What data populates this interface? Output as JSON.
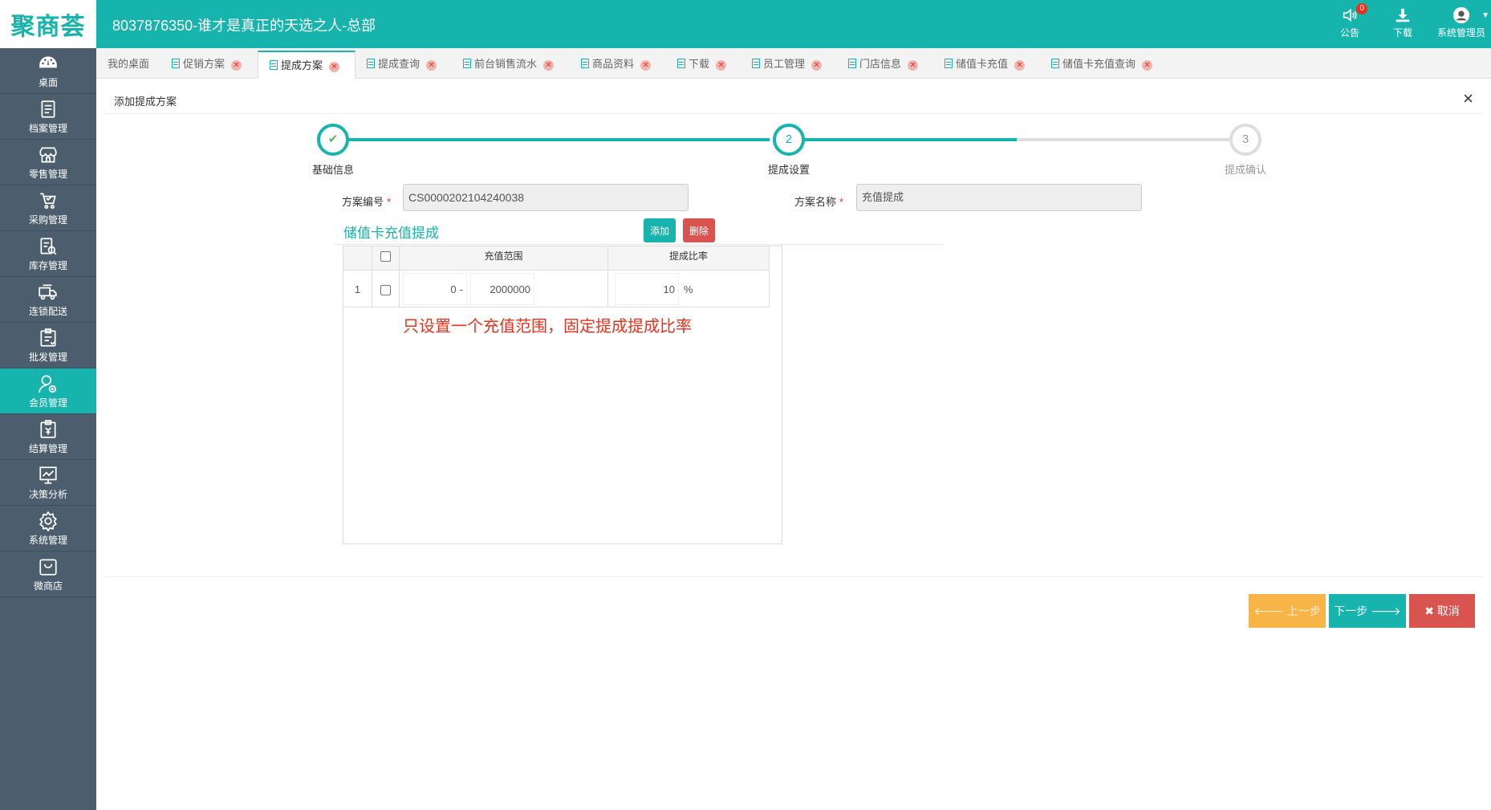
{
  "header": {
    "logo": "聚商荟",
    "title": "8037876350-谁才是真正的天选之人-总部",
    "notice_label": "公告",
    "notice_count": "0",
    "download_label": "下载",
    "user_label": "系统管理员"
  },
  "sidebar": {
    "items": [
      {
        "label": "桌面",
        "icon": "dashboard-icon"
      },
      {
        "label": "档案管理",
        "icon": "archive-icon"
      },
      {
        "label": "零售管理",
        "icon": "store-icon"
      },
      {
        "label": "采购管理",
        "icon": "cart-icon"
      },
      {
        "label": "库存管理",
        "icon": "inventory-icon"
      },
      {
        "label": "连锁配送",
        "icon": "truck-icon"
      },
      {
        "label": "批发管理",
        "icon": "wholesale-icon"
      },
      {
        "label": "会员管理",
        "icon": "member-icon"
      },
      {
        "label": "结算管理",
        "icon": "settlement-icon"
      },
      {
        "label": "决策分析",
        "icon": "chart-icon"
      },
      {
        "label": "系统管理",
        "icon": "gear-icon"
      },
      {
        "label": "微商店",
        "icon": "shop-bag-icon"
      }
    ]
  },
  "tabs": [
    {
      "label": "我的桌面"
    },
    {
      "label": "促销方案"
    },
    {
      "label": "提成方案"
    },
    {
      "label": "提成查询"
    },
    {
      "label": "前台销售流水"
    },
    {
      "label": "商品资料"
    },
    {
      "label": "下载"
    },
    {
      "label": "员工管理"
    },
    {
      "label": "门店信息"
    },
    {
      "label": "储值卡充值"
    },
    {
      "label": "储值卡充值查询"
    }
  ],
  "panel": {
    "title": "添加提成方案",
    "close": "×"
  },
  "steps": [
    {
      "label": "基础信息",
      "number": "✔"
    },
    {
      "label": "提成设置",
      "number": "2"
    },
    {
      "label": "提成确认",
      "number": "3"
    }
  ],
  "form": {
    "code_label": "方案编号",
    "code_value": "CS0000202104240038",
    "name_label": "方案名称",
    "name_value": "充值提成",
    "required_mark": "*"
  },
  "section": {
    "title": "储值卡充值提成",
    "add_label": "添加",
    "delete_label": "删除"
  },
  "table": {
    "headers": [
      "充值范围",
      "提成比率"
    ],
    "rows": [
      {
        "index": "1",
        "range_from": "0",
        "range_sep": "-",
        "range_to": "2000000",
        "rate": "10",
        "rate_unit": "%"
      }
    ]
  },
  "annotation": "只设置一个充值范围，固定提成提成比率",
  "actions": {
    "prev_label": "上一步",
    "next_label": "下一步",
    "cancel_label": "取消"
  }
}
